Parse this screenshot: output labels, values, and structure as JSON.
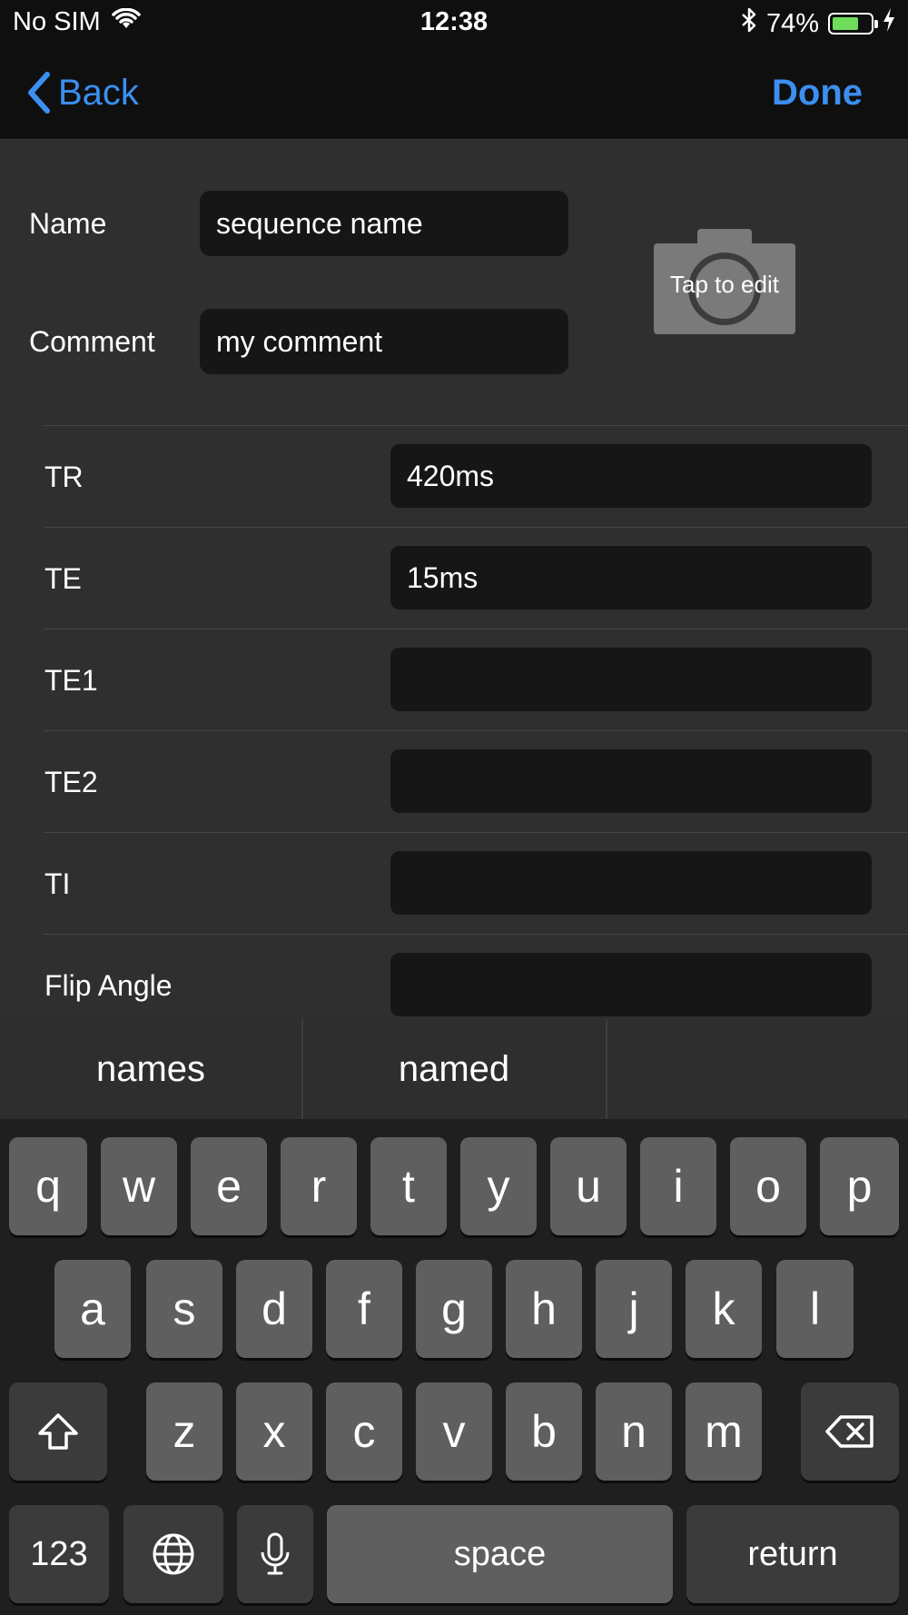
{
  "status_bar": {
    "carrier": "No SIM",
    "time": "12:38",
    "battery": "74%",
    "battery_level": 0.74,
    "icons": [
      "wifi-icon",
      "bluetooth-icon",
      "battery-icon",
      "charging-icon"
    ]
  },
  "nav": {
    "back_label": "Back",
    "done_label": "Done",
    "accent": "#3b8ff0"
  },
  "form": {
    "name_label": "Name",
    "name_value": "sequence name",
    "comment_label": "Comment",
    "comment_value": "my comment",
    "photo_caption": "Tap to edit",
    "rows": [
      {
        "label": "TR",
        "value": "420ms"
      },
      {
        "label": "TE",
        "value": "15ms"
      },
      {
        "label": "TE1",
        "value": ""
      },
      {
        "label": "TE2",
        "value": ""
      },
      {
        "label": "TI",
        "value": ""
      },
      {
        "label": "Flip Angle",
        "value": ""
      }
    ]
  },
  "suggestions": [
    "names",
    "named",
    ""
  ],
  "keyboard": {
    "row1": [
      "q",
      "w",
      "e",
      "r",
      "t",
      "y",
      "u",
      "i",
      "o",
      "p"
    ],
    "row2": [
      "a",
      "s",
      "d",
      "f",
      "g",
      "h",
      "j",
      "k",
      "l"
    ],
    "row3": [
      "z",
      "x",
      "c",
      "v",
      "b",
      "n",
      "m"
    ],
    "numbers_label": "123",
    "space_label": "space",
    "return_label": "return"
  }
}
